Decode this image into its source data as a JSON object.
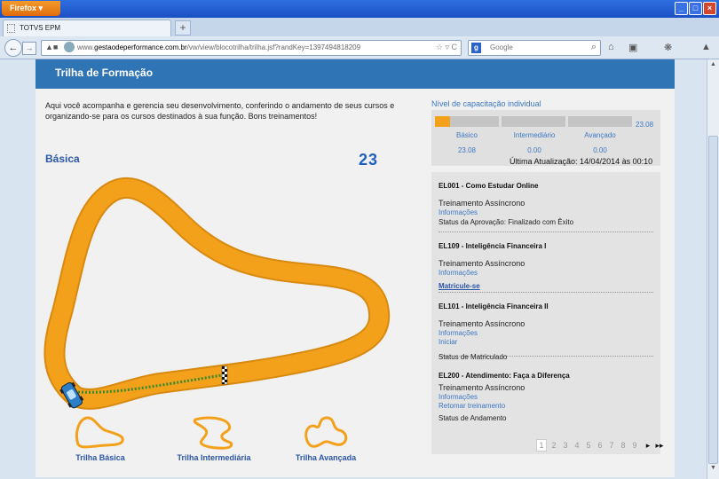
{
  "browser": {
    "menu_button": "Firefox",
    "tab_title": "TOTVS EPM",
    "new_tab": "+",
    "url_prefix": "www.",
    "url_domain": "gestaodeperformance.com.br",
    "url_rest": "/vw/view/blocotrilha/trilha.jsf?randKey=1397494818209",
    "search_engine": "Google",
    "search_engine_icon": "g",
    "win_min": "_",
    "win_max": "□",
    "win_close": "×"
  },
  "page": {
    "header_title": "Trilha de Formação",
    "intro": "Aqui você acompanha e gerencia seu desenvolvimento, conferindo o andamento de seus cursos e organizando-se para os cursos destinados à sua função. Bons treinamentos!",
    "track_title": "Básica",
    "track_number": "23"
  },
  "track_links": [
    {
      "label": "Trilha Básica"
    },
    {
      "label": "Trilha Intermediária"
    },
    {
      "label": "Trilha Avançada"
    }
  ],
  "capacity": {
    "title": "Nível de capacitação individual",
    "total": "23.08",
    "levels": [
      {
        "label": "Básico",
        "value": "23.08",
        "fill": 0.23
      },
      {
        "label": "Intermediário",
        "value": "0.00",
        "fill": 0
      },
      {
        "label": "Avançado",
        "value": "0.00",
        "fill": 0
      }
    ],
    "updated": "Última Atualização: 14/04/2014 às 00:10"
  },
  "courses": [
    {
      "title": "EL001 - Como Estudar Online",
      "type": "Treinamento Assíncrono",
      "links": [
        "Informações"
      ],
      "action": "",
      "status": "Status da Aprovação: Finalizado com Êxito"
    },
    {
      "title": "EL109 - Inteligência Financeira I",
      "type": "Treinamento Assíncrono",
      "links": [
        "Informações"
      ],
      "action": "Matricule-se",
      "status": ""
    },
    {
      "title": "EL101 - Inteligência Financeira II",
      "type": "Treinamento Assíncrono",
      "links": [
        "Informações",
        "Iniciar"
      ],
      "action": "",
      "status": "Status de Matriculado"
    },
    {
      "title": "EL200 - Atendimento: Faça a Diferença",
      "type": "Treinamento Assíncrono",
      "links": [
        "Informações",
        "Retomar treinamento"
      ],
      "action": "",
      "status": "Status de Andamento"
    }
  ],
  "pager": {
    "pages": [
      "1",
      "2",
      "3",
      "4",
      "5",
      "6",
      "7",
      "8",
      "9"
    ],
    "next": "▸",
    "last": "▸▸"
  },
  "colors": {
    "header": "#2f75b5",
    "track": "#f3a01a",
    "link": "#3b78c4"
  }
}
